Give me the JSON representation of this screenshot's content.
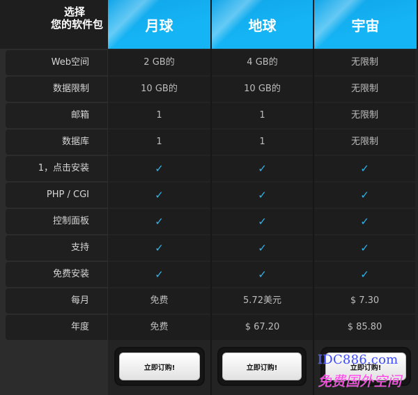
{
  "header": {
    "label_line1": "选择",
    "label_line2": "您的软件包",
    "plans": [
      "月球",
      "地球",
      "宇宙"
    ]
  },
  "rows": [
    {
      "label": "Web空间",
      "values": [
        "2 GB的",
        "4 GB的",
        "无限制"
      ]
    },
    {
      "label": "数据限制",
      "values": [
        "10 GB的",
        "10 GB的",
        "无限制"
      ]
    },
    {
      "label": "邮箱",
      "values": [
        "1",
        "1",
        "无限制"
      ]
    },
    {
      "label": "数据库",
      "values": [
        "1",
        "1",
        "无限制"
      ]
    },
    {
      "label": "1，点击安装",
      "values": [
        "✓",
        "✓",
        "✓"
      ]
    },
    {
      "label": "PHP / CGI",
      "values": [
        "✓",
        "✓",
        "✓"
      ]
    },
    {
      "label": "控制面板",
      "values": [
        "✓",
        "✓",
        "✓"
      ]
    },
    {
      "label": "支持",
      "values": [
        "✓",
        "✓",
        "✓"
      ]
    },
    {
      "label": "免费安装",
      "values": [
        "✓",
        "✓",
        "✓"
      ]
    },
    {
      "label": "每月",
      "values": [
        "免费",
        "5.72美元",
        "$ 7.30"
      ]
    },
    {
      "label": "年度",
      "values": [
        "免费",
        "$ 67.20",
        "$ 85.80"
      ]
    }
  ],
  "buttons": {
    "buy_label": "立即订购!"
  },
  "watermark": {
    "line1": "IDC886.com",
    "line2": "免费国外空间"
  },
  "colors": {
    "accent": "#15b4f4",
    "check": "#2fb6ee",
    "row_bg": "#1d1d1d",
    "label_bg": "#1f1f1f"
  }
}
